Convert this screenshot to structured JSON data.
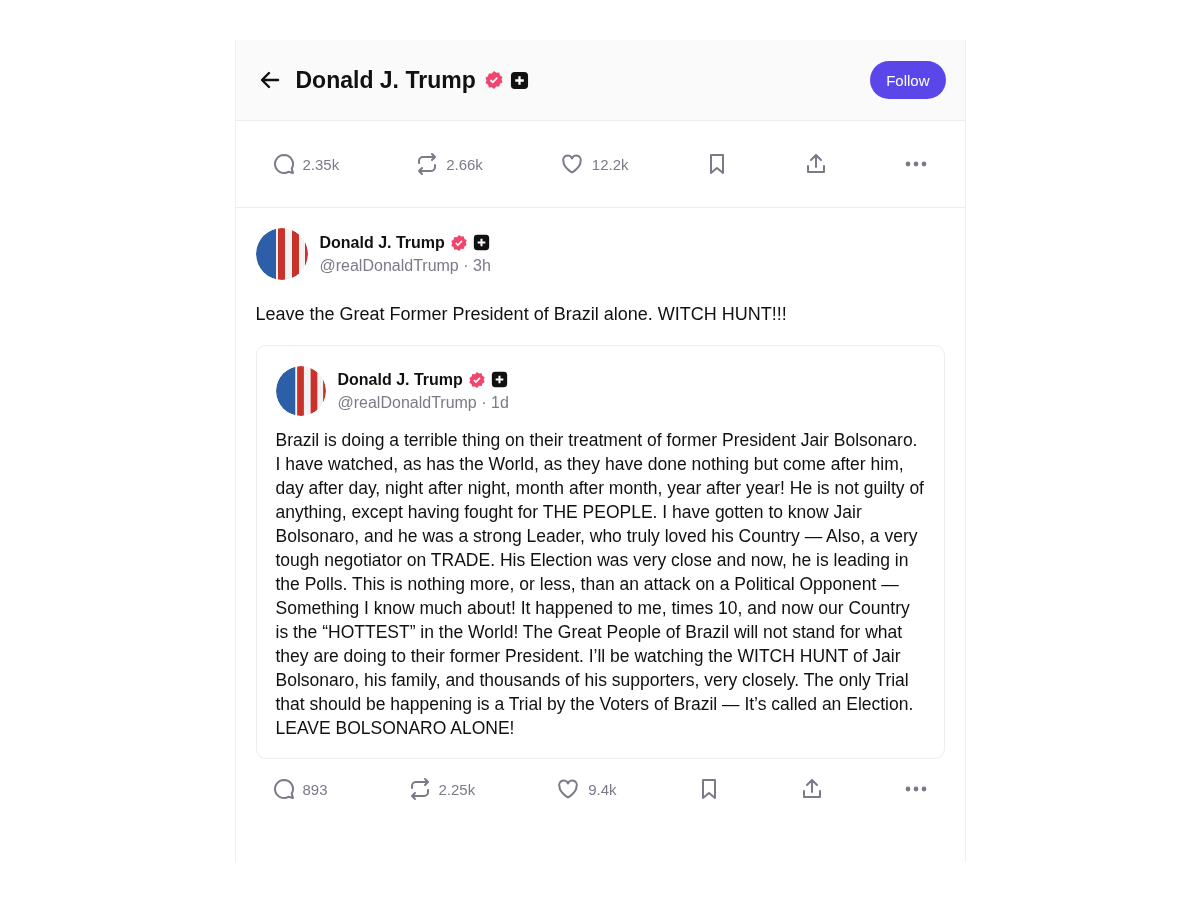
{
  "header": {
    "title": "Donald J. Trump",
    "follow_label": "Follow"
  },
  "previous_actions": [
    {
      "kind": "reply",
      "count": "2.35k"
    },
    {
      "kind": "repost",
      "count": "2.66k"
    },
    {
      "kind": "like",
      "count": "12.2k"
    },
    {
      "kind": "bookmark"
    },
    {
      "kind": "share"
    },
    {
      "kind": "more"
    }
  ],
  "post": {
    "author": "Donald J. Trump",
    "handle": "@realDonaldTrump · 3h",
    "text": "Leave the Great Former President of Brazil alone. WITCH HUNT!!!",
    "quote": {
      "author": "Donald J. Trump",
      "handle": "@realDonaldTrump · 1d",
      "text": "Brazil is doing a terrible thing on their treatment of former President Jair Bolsonaro. I have watched, as has the World, as they have done nothing but come after him, day after day, night after night, month after month, year after year! He is not guilty of anything, except having fought for THE PEOPLE. I have gotten to know Jair Bolsonaro, and he was a strong Leader, who truly loved his Country — Also, a very tough negotiator on TRADE. His Election was very close and now, he is leading in the Polls. This is nothing more, or less, than an attack on a Political Opponent — Something I know much about! It happened to me, times 10, and now our Country is the “HOTTEST” in the World! The Great People of Brazil will not stand for what they are doing to their former President. I’ll be watching the WITCH HUNT of Jair Bolsonaro, his family, and thousands of his supporters, very closely. The only Trial that should be happening is a Trial by the Voters of Brazil — It’s called an Election. LEAVE BOLSONARO ALONE!"
    },
    "actions": [
      {
        "kind": "reply",
        "count": "893"
      },
      {
        "kind": "repost",
        "count": "2.25k"
      },
      {
        "kind": "like",
        "count": "9.4k"
      },
      {
        "kind": "bookmark"
      },
      {
        "kind": "share"
      },
      {
        "kind": "more"
      }
    ]
  }
}
